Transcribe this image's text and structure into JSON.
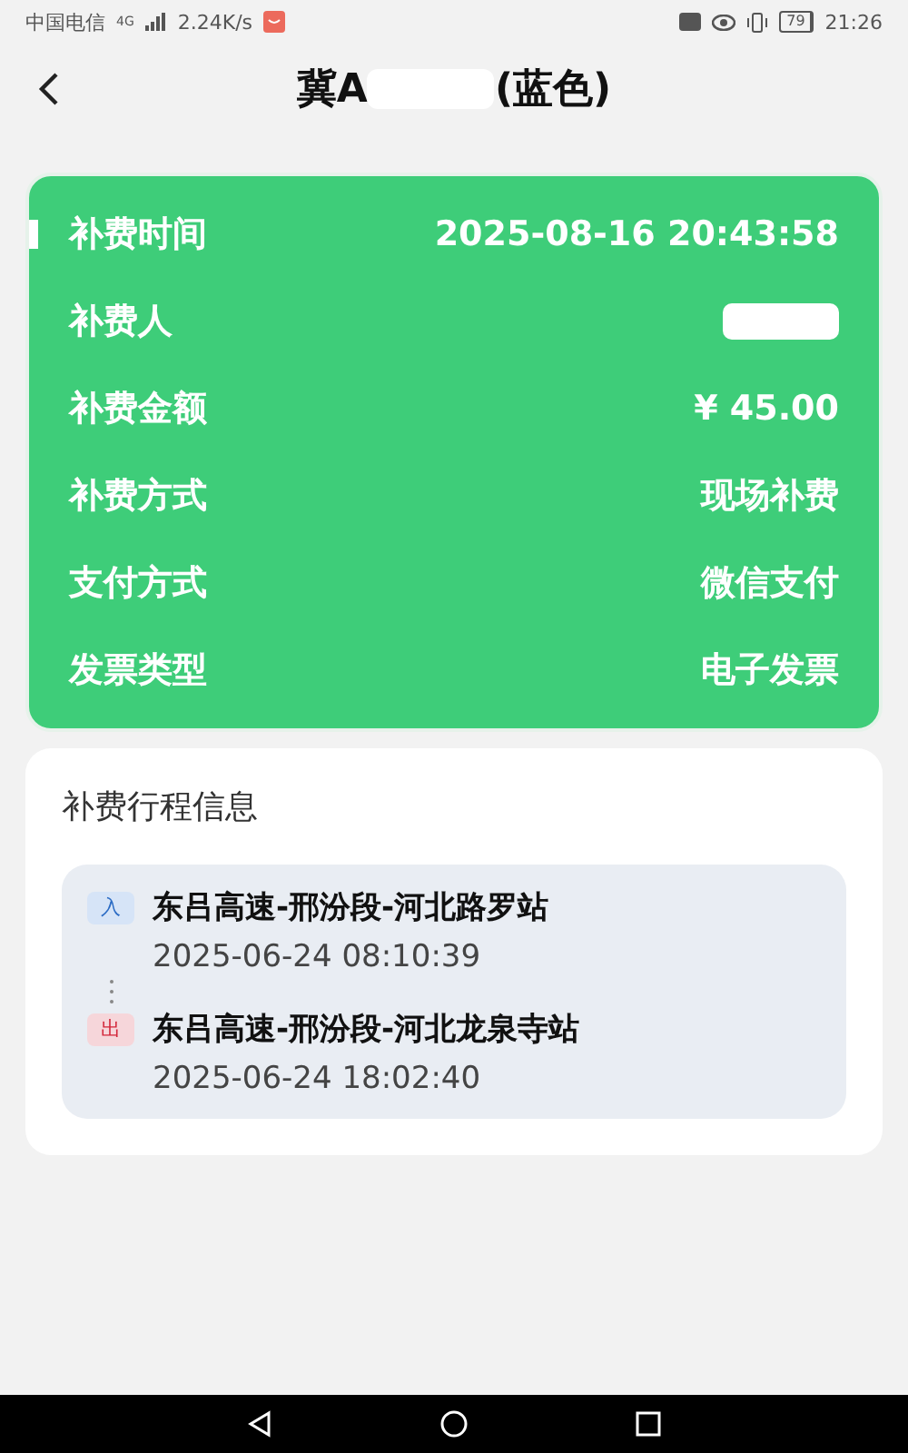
{
  "status_bar": {
    "carrier": "中国电信",
    "network": "4G",
    "speed": "2.24K/s",
    "battery": "79",
    "time": "21:26"
  },
  "header": {
    "title_start": "冀A",
    "title_hidden": true,
    "title_end": "(蓝色)"
  },
  "summary": {
    "rows": [
      {
        "label": "补费时间",
        "value": "2025-08-16 20:43:58",
        "kind": "text",
        "marked": true
      },
      {
        "label": "补费人",
        "kind": "hidden",
        "marked": false
      },
      {
        "label": "补费金额",
        "value": "¥ 45.00",
        "kind": "text",
        "marked": false
      },
      {
        "label": "补费方式",
        "value": "现场补费",
        "kind": "text",
        "marked": false
      },
      {
        "label": "支付方式",
        "value": "微信支付",
        "kind": "text",
        "marked": false
      },
      {
        "label": "发票类型",
        "value": "电子发票",
        "kind": "text",
        "marked": false
      }
    ]
  },
  "trip": {
    "heading": "补费行程信息",
    "stops": [
      {
        "kind": "entry",
        "tag": "入",
        "station": "东吕高速-邢汾段-河北路罗站",
        "time": "2025-06-24 08:10:39"
      },
      {
        "kind": "exit",
        "tag": "出",
        "station": "东吕高速-邢汾段-河北龙泉寺站",
        "time": "2025-06-24 18:02:40"
      }
    ]
  }
}
